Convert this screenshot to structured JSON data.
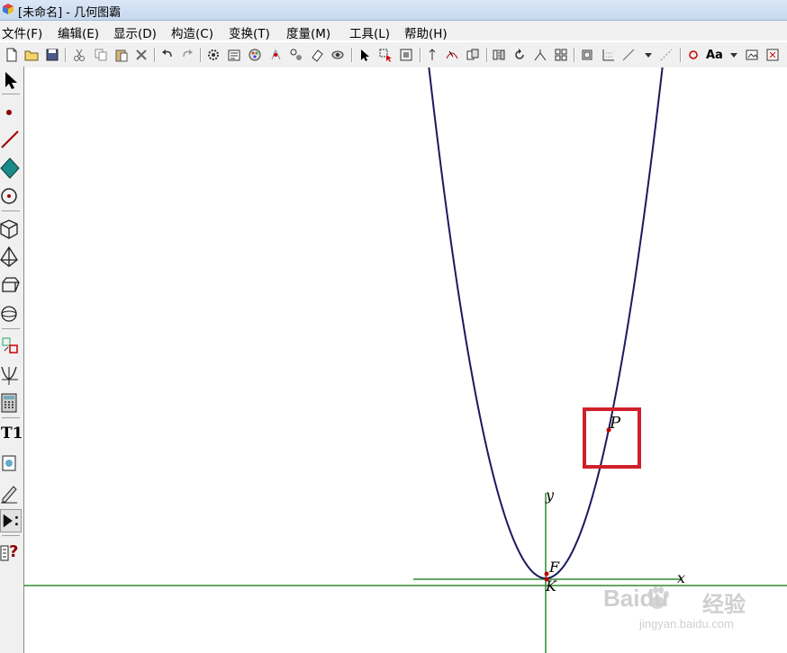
{
  "window": {
    "title": "[未命名] - 几何图霸"
  },
  "menu": {
    "items": [
      "文件(F)",
      "编辑(E)",
      "显示(D)",
      "构造(C)",
      "变换(T)",
      "度量(M)",
      "工具(L)",
      "帮助(H)"
    ]
  },
  "toolbar": {
    "icons": [
      "new-file-icon",
      "open-folder-icon",
      "save-icon",
      "cut-icon",
      "copy-icon",
      "paste-icon",
      "delete-icon",
      "undo-icon",
      "redo-icon",
      "settings-icon",
      "properties-icon",
      "color-icon",
      "point-on-object-icon",
      "snap-icon",
      "eraser-icon",
      "hide-show-icon",
      "select-arrow-icon",
      "select-region-icon",
      "select-all-icon",
      "animate-icon",
      "trace-icon",
      "group-icon",
      "mirror-icon",
      "rotate-icon",
      "scale-icon",
      "grid-icon",
      "frame-icon",
      "axes-icon",
      "line-style-icon",
      "dropdown-arrow-icon",
      "dotted-line-icon",
      "point-style-icon",
      "text-style-icon",
      "dropdown-arrow-icon",
      "screenshot-icon",
      "export-icon"
    ],
    "text_style_label": "Aa"
  },
  "sidebar": {
    "tools": [
      "select-arrow-icon",
      "point-tool-icon",
      "line-tool-icon",
      "polygon-tool-icon",
      "circle-tool-icon",
      "cube-tool-icon",
      "pyramid-tool-icon",
      "prism-tool-icon",
      "sphere-tool-icon",
      "transform-tool-icon",
      "graph-function-icon",
      "calculator-icon",
      "text-tool-icon",
      "image-tool-icon",
      "pen-tool-icon",
      "animation-tool-icon",
      "help-tool-icon"
    ],
    "text_tool_label": "T1",
    "help_tool_label": "?"
  },
  "canvas": {
    "labels": {
      "y_axis": "y",
      "x_axis": "x",
      "point_p": "P",
      "point_f": "F",
      "point_k": "K"
    },
    "colors": {
      "curve": "#1a1a5e",
      "axes": "#2e8b2e",
      "highlight": "#d0202a",
      "point": "#c00000"
    }
  },
  "watermark": {
    "brand": "Baidu",
    "product": "经验",
    "url": "jingyan.baidu.com"
  }
}
